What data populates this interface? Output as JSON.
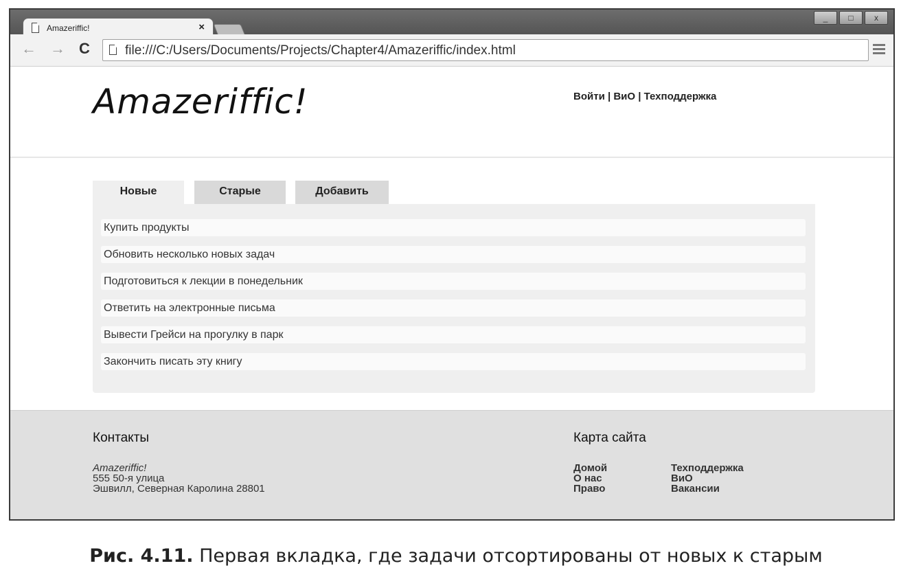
{
  "browser": {
    "tab_title": "Amazeriffic!",
    "tab_close": "×",
    "url": "file:///C:/Users/Documents/Projects/Chapter4/Amazeriffic/index.html",
    "window_buttons": {
      "minimize": "_",
      "maximize": "□",
      "close": "x"
    }
  },
  "header": {
    "logo": "Amazeriffic!",
    "links": [
      "Войти",
      "ВиО",
      "Техподдержка"
    ],
    "separator": " | "
  },
  "tabs": [
    "Новые",
    "Старые",
    "Добавить"
  ],
  "todos": [
    "Купить продукты",
    "Обновить несколько новых задач",
    "Подготовиться к лекции в понедельник",
    "Ответить на электронные письма",
    "Вывести Грейси на прогулку в парк",
    "Закончить писать эту книгу"
  ],
  "footer": {
    "contacts": {
      "heading": "Контакты",
      "name": "Amazeriffic!",
      "address1": "555 50-я улица",
      "address2": "Эшвилл, Северная Каролина 28801"
    },
    "sitemap": {
      "heading": "Карта сайта",
      "col1": [
        "Домой",
        "О нас",
        "Право"
      ],
      "col2": [
        "Техподдержка",
        "ВиО",
        "Вакансии"
      ]
    }
  },
  "caption": {
    "label": "Рис. 4.11.",
    "text": " Первая вкладка, где задачи отсортированы от новых к старым"
  }
}
